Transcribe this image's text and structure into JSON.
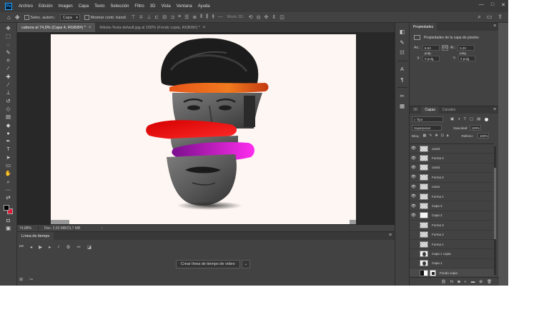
{
  "menu": {
    "logo": "Ps",
    "items": [
      "Archivo",
      "Edición",
      "Imagen",
      "Capa",
      "Texto",
      "Selección",
      "Filtro",
      "3D",
      "Vista",
      "Ventana",
      "Ayuda"
    ]
  },
  "window_controls": {
    "minimize": "—",
    "maximize": "□",
    "close": "✕"
  },
  "options": {
    "autoselect_label": "Selec. autom.:",
    "autoselect_target": "Capa",
    "show_transform_label": "Mostrar contr. transf.",
    "mode_3d_label": "Modo 3D:"
  },
  "tabs": [
    {
      "label": "cabeza al 74,9% (Capa 4, RGB/8#) *",
      "active": true
    },
    {
      "label": "Nikola-Tesla-default.jpg al 100% (Fondo copia, RGB/8#) *",
      "active": false
    }
  ],
  "status": {
    "zoom": "74,88%",
    "doc": "Doc: 2,53 MB/23,7 MB"
  },
  "timeline": {
    "title": "Línea de tiempo",
    "create_label": "Crear línea de tiempo de vídeo"
  },
  "properties": {
    "tab_label": "Propiedades",
    "subtitle": "Propiedades de la capa de píxeles",
    "width_label": "An.:",
    "width_value": "8,83 pulg.",
    "link_label": "GO",
    "height_label": "Al.:",
    "height_value": "5,33 pulg.",
    "x_label": "X:",
    "x_value": "0 pulg.",
    "y_label": "Y:",
    "y_value": "0 pulg."
  },
  "layers_panel": {
    "tabs": [
      "3D",
      "Capas",
      "Canales"
    ],
    "active_tab": "Capas",
    "filter_label": "Tipo",
    "blend_mode": "Superponer",
    "opacity_label": "Opacidad:",
    "opacity_value": "100%",
    "lock_label": "Bloq.:",
    "fill_label": "Relleno:",
    "fill_value": "100%",
    "layers": [
      {
        "name": "cara3",
        "visible": true,
        "thumb": "checker"
      },
      {
        "name": "Forma 4",
        "visible": true,
        "thumb": "checker"
      },
      {
        "name": "cara2",
        "visible": true,
        "thumb": "checker"
      },
      {
        "name": "Forma 2",
        "visible": true,
        "thumb": "checker"
      },
      {
        "name": "cara1",
        "visible": true,
        "thumb": "checker"
      },
      {
        "name": "Forma 1",
        "visible": true,
        "thumb": "checker"
      },
      {
        "name": "Capa 3",
        "visible": true,
        "thumb": "checker"
      },
      {
        "name": "Capa 2",
        "visible": true,
        "thumb": "solid"
      },
      {
        "name": "Forma 3",
        "visible": false,
        "thumb": "checker"
      },
      {
        "name": "Forma 2",
        "visible": false,
        "thumb": "checker"
      },
      {
        "name": "Forma 1",
        "visible": false,
        "thumb": "checker"
      },
      {
        "name": "Capa 1 copia",
        "visible": false,
        "thumb": "face"
      },
      {
        "name": "Capa 1",
        "visible": false,
        "thumb": "face"
      },
      {
        "name": "Fondo copia",
        "visible": false,
        "thumb": "bw"
      }
    ]
  },
  "colors": {
    "foreground": "#000000",
    "background": "#e01b3a",
    "accent": "#31a8ff"
  }
}
